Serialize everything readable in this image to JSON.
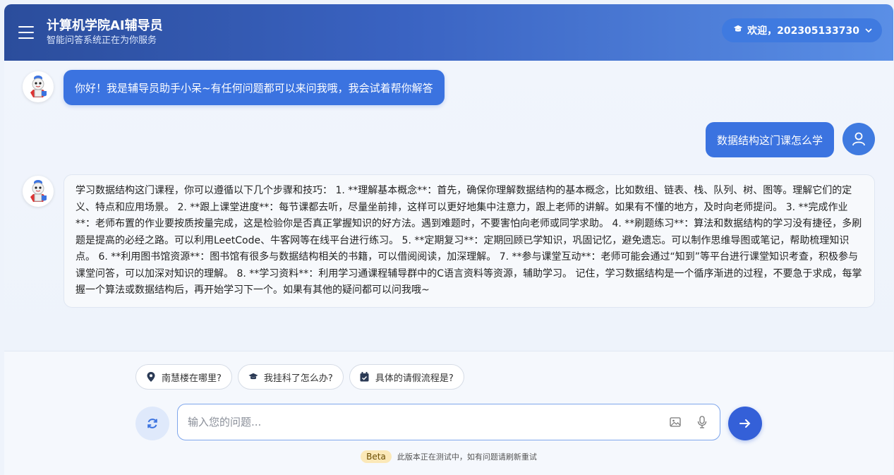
{
  "header": {
    "title": "计算机学院AI辅导员",
    "subtitle": "智能问答系统正在为你服务",
    "user_label": "欢迎，202305133730",
    "menu_icon": "hamburger-icon",
    "user_icon": "graduation-cap-icon"
  },
  "messages": [
    {
      "role": "bot",
      "text": "你好！我是辅导员助手小呆~有任何问题都可以来问我哦，我会试着帮你解答"
    },
    {
      "role": "user",
      "text": "数据结构这门课怎么学"
    },
    {
      "role": "bot",
      "text": "学习数据结构这门课程，你可以遵循以下几个步骤和技巧： 1. **理解基本概念**：首先，确保你理解数据结构的基本概念，比如数组、链表、栈、队列、树、图等。理解它们的定义、特点和应用场景。 2. **跟上课堂进度**：每节课都去听，尽量坐前排，这样可以更好地集中注意力，跟上老师的讲解。如果有不懂的地方，及时向老师提问。 3. **完成作业**：老师布置的作业要按质按量完成，这是检验你是否真正掌握知识的好方法。遇到难题时，不要害怕向老师或同学求助。 4. **刷题练习**：算法和数据结构的学习没有捷径，多刷题是提高的必经之路。可以利用LeetCode、牛客网等在线平台进行练习。 5. **定期复习**：定期回顾已学知识，巩固记忆，避免遗忘。可以制作思维导图或笔记，帮助梳理知识点。 6. **利用图书馆资源**：图书馆有很多与数据结构相关的书籍，可以借阅阅读，加深理解。 7. **参与课堂互动**：老师可能会通过“知到”等平台进行课堂知识考查，积极参与课堂问答，可以加深对知识的理解。 8. **学习资料**：利用学习通课程辅导群中的C语言资料等资源，辅助学习。 记住，学习数据结构是一个循序渐进的过程，不要急于求成，每掌握一个算法或数据结构后，再开始学习下一个。如果有其他的疑问都可以问我哦~"
    }
  ],
  "suggestions": [
    {
      "label": "南慧楼在哪里?",
      "icon": "map-pin-icon"
    },
    {
      "label": "我挂科了怎么办?",
      "icon": "graduation-cap-icon"
    },
    {
      "label": "具体的请假流程是?",
      "icon": "calendar-check-icon"
    }
  ],
  "input": {
    "placeholder": "输入您的问题...",
    "value": ""
  },
  "footer": {
    "badge": "Beta",
    "note": "此版本正在测试中，如有问题请刷新重试"
  },
  "colors": {
    "primary": "#3b73e0",
    "header_start": "#2b4d9c",
    "header_end": "#5a8fe6",
    "send": "#3460d8"
  }
}
